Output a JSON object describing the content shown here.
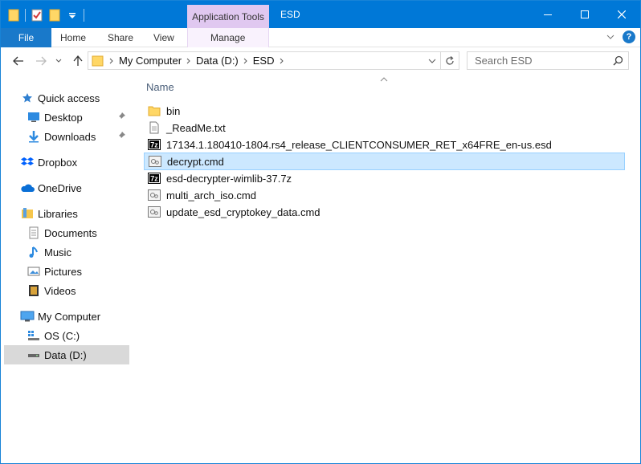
{
  "titlebar": {
    "context_tab": "Application Tools",
    "title": "ESD",
    "accent": "#0078d7"
  },
  "ribbon": {
    "file": "File",
    "tabs": [
      "Home",
      "Share",
      "View",
      "Manage"
    ]
  },
  "address": {
    "crumbs": [
      "My Computer",
      "Data (D:)",
      "ESD"
    ]
  },
  "search": {
    "placeholder": "Search ESD"
  },
  "navpane": {
    "items": [
      {
        "label": "Quick access",
        "icon": "star-icon"
      },
      {
        "label": "Desktop",
        "icon": "desktop-icon",
        "pinned": true
      },
      {
        "label": "Downloads",
        "icon": "downloads-icon",
        "pinned": true
      },
      {
        "label": "Dropbox",
        "icon": "dropbox-icon"
      },
      {
        "label": "OneDrive",
        "icon": "onedrive-icon"
      },
      {
        "label": "Libraries",
        "icon": "libraries-icon"
      },
      {
        "label": "Documents",
        "icon": "documents-icon"
      },
      {
        "label": "Music",
        "icon": "music-icon"
      },
      {
        "label": "Pictures",
        "icon": "pictures-icon"
      },
      {
        "label": "Videos",
        "icon": "videos-icon"
      },
      {
        "label": "My Computer",
        "icon": "computer-icon"
      },
      {
        "label": "OS (C:)",
        "icon": "drive-c-icon"
      },
      {
        "label": "Data (D:)",
        "icon": "drive-d-icon",
        "selected": true
      }
    ]
  },
  "content": {
    "column_name": "Name",
    "files": [
      {
        "name": "bin",
        "icon": "folder-icon"
      },
      {
        "name": "_ReadMe.txt",
        "icon": "text-file-icon"
      },
      {
        "name": "17134.1.180410-1804.rs4_release_CLIENTCONSUMER_RET_x64FRE_en-us.esd",
        "icon": "7z-archive-icon"
      },
      {
        "name": "decrypt.cmd",
        "icon": "cmd-file-icon",
        "selected": true
      },
      {
        "name": "esd-decrypter-wimlib-37.7z",
        "icon": "7z-archive-icon"
      },
      {
        "name": "multi_arch_iso.cmd",
        "icon": "cmd-file-icon"
      },
      {
        "name": "update_esd_cryptokey_data.cmd",
        "icon": "cmd-file-icon"
      }
    ]
  }
}
